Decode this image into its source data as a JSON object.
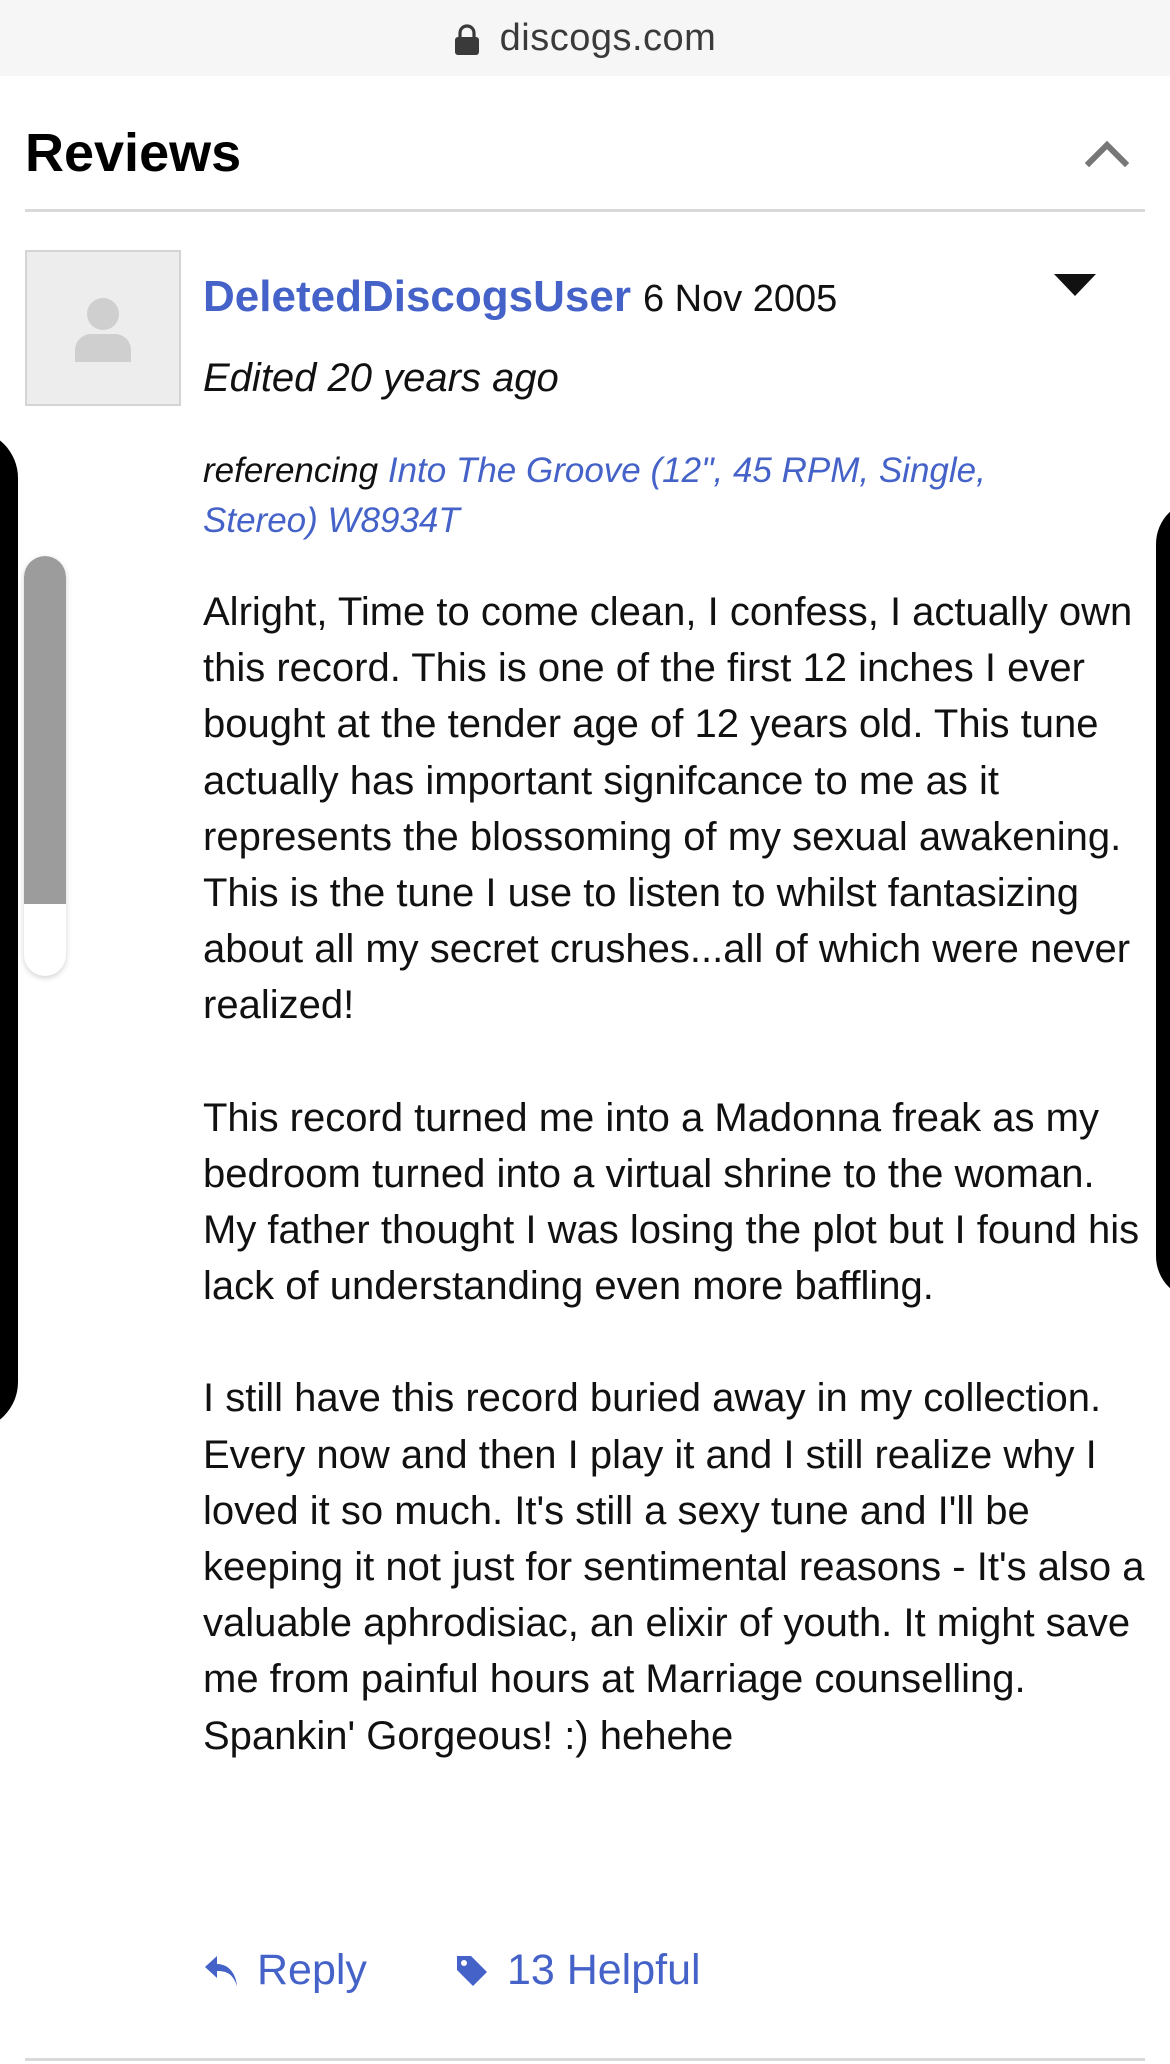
{
  "browser": {
    "domain": "discogs.com"
  },
  "section": {
    "title": "Reviews"
  },
  "review": {
    "username": "DeletedDiscogsUser",
    "date": "6 Nov 2005",
    "edited": "Edited 20 years ago",
    "referencing_label": "referencing",
    "release_link": "Into The Groove (12\", 45 RPM, Single, Stereo) W8934T",
    "paragraphs": [
      "Alright, Time to come clean, I confess, I actually own this record. This is one of the first 12 inches I ever bought at the tender age of 12 years old. This tune actually has important signifcance to me as it represents the blossoming of my sexual awakening. This is the tune I use to listen to whilst fantasizing about all my secret crushes...all of which were never realized!",
      "This record turned me into a Madonna freak as my bedroom turned into a virtual shrine to the woman. My father thought I was losing the plot but I found his lack of understanding even more baffling.",
      "I still have this record buried away in my collection. Every now and then I play it and I still realize why I loved it so much. It's still a sexy tune and I'll be keeping it not just for sentimental reasons - It's also a valuable aphrodisiac, an elixir of youth. It might save me from painful hours at Marriage counselling. Spankin' Gorgeous! :) hehehe"
    ],
    "reply_label": "Reply",
    "helpful_label": "13 Helpful"
  },
  "colors": {
    "link": "#4462c7",
    "divider": "#d9d9d9",
    "scrollbar_thumb": "#9c9c9c"
  },
  "icons": {
    "url_bar": "lock-icon",
    "section_toggle": "chevron-up-icon",
    "review_menu": "caret-down-icon",
    "avatar": "user-placeholder-icon",
    "reply": "reply-arrow-icon",
    "helpful": "tag-icon"
  }
}
